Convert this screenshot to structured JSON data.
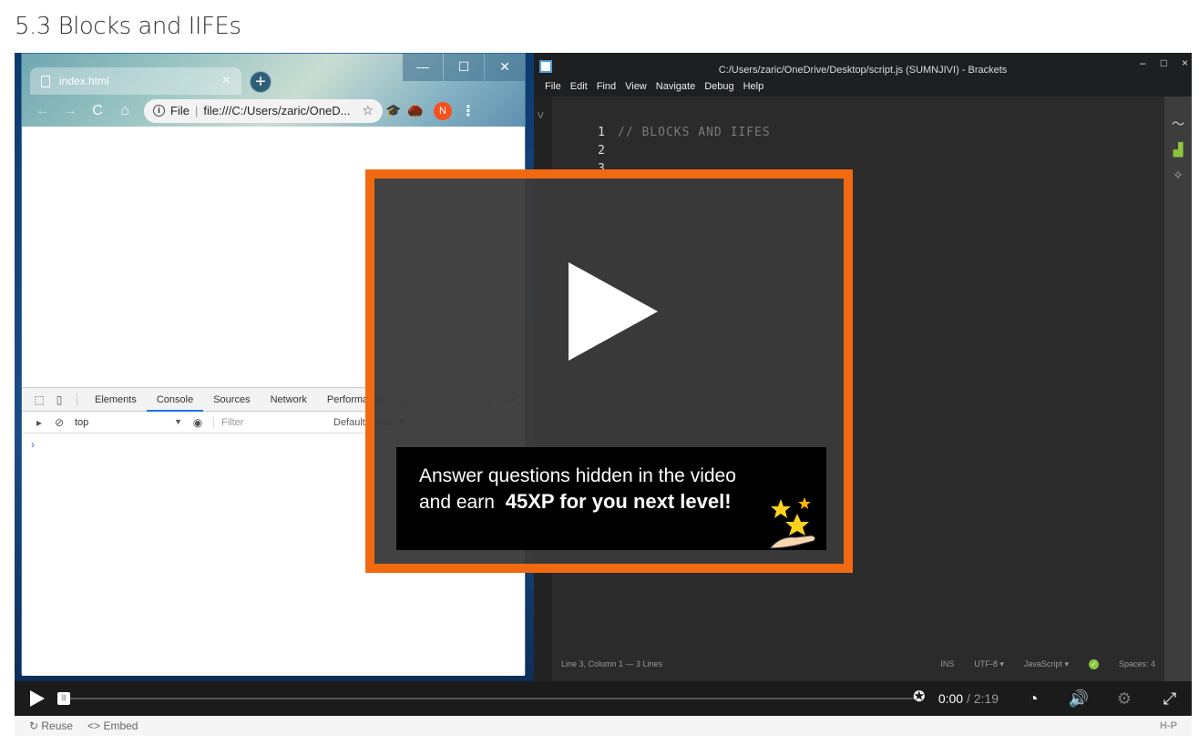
{
  "page": {
    "title": "5.3 Blocks and IIFEs"
  },
  "chrome": {
    "tab_title": "index.html",
    "tab_close": "×",
    "new_tab": "+",
    "win_minimize": "—",
    "win_maximize": "☐",
    "win_close": "✕",
    "omnibox": {
      "scheme": "File",
      "url": "file:///C:/Users/zaric/OneD...",
      "star": "☆"
    },
    "profile_initial": "N",
    "menu": "⋮"
  },
  "devtools": {
    "tabs": [
      "Elements",
      "Console",
      "Sources",
      "Network",
      "Performance"
    ],
    "active_tab": "Console",
    "more": "»",
    "context": "top",
    "filter_placeholder": "Filter",
    "levels": "Default levels ▼",
    "prompt": "›"
  },
  "brackets": {
    "title": "C:/Users/zaric/OneDrive/Desktop/script.js (SUMNJIVI) - Brackets",
    "menu": [
      "File",
      "Edit",
      "Find",
      "View",
      "Navigate",
      "Debug",
      "Help"
    ],
    "ctrl_min": "–",
    "ctrl_max": "□",
    "ctrl_close": "×",
    "gutter_label": "V",
    "lines": [
      {
        "n": "1",
        "code": "// BLOCKS AND IIFES"
      },
      {
        "n": "2",
        "code": ""
      },
      {
        "n": "3",
        "code": ""
      }
    ],
    "status": {
      "cursor": "Line 3, Column 1 — 3 Lines",
      "ins": "INS",
      "encoding": "UTF-8 ▾",
      "language": "JavaScript ▾",
      "spaces": "Spaces: 4"
    }
  },
  "overlay": {
    "line1": "Answer  questions hidden in  the video",
    "line2_prefix": "and earn ",
    "line2_bold": "45XP for you next level!"
  },
  "player": {
    "current_time": "0:00",
    "separator": " / ",
    "duration": "2:19"
  },
  "footer": {
    "reuse": "Reuse",
    "embed": "Embed",
    "brand": "H-P"
  }
}
